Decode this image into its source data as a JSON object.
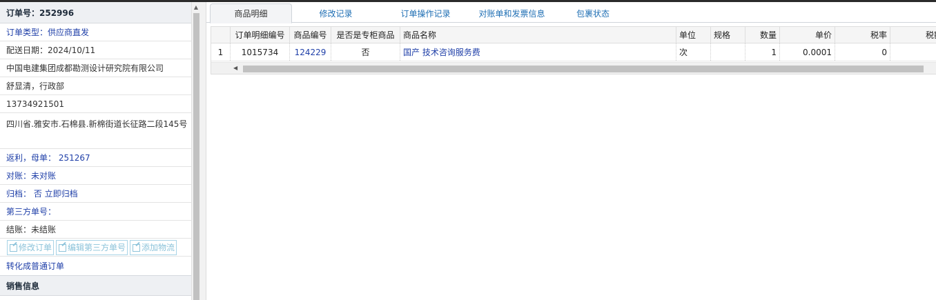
{
  "order": {
    "header": "订单号：252996",
    "rows": [
      {
        "text": "订单类型：供应商直发",
        "blue": true
      },
      {
        "text": "配送日期：2024/10/11",
        "blue": false
      },
      {
        "text": "中国电建集团成都勘测设计研究院有限公司",
        "blue": false
      },
      {
        "text": "舒显清，行政部",
        "blue": false
      },
      {
        "text": "13734921501",
        "blue": false
      },
      {
        "text": "四川省.雅安市.石棉县.新棉街道长征路二段145号",
        "blue": false,
        "tall": true
      },
      {
        "text": "返利，母单： 251267",
        "blue": true
      },
      {
        "text": "对账：未对账",
        "blue": true
      },
      {
        "text": "归档： 否 立即归档",
        "blue": true
      },
      {
        "text": "第三方单号：",
        "blue": true
      },
      {
        "text": "结账：未结账",
        "blue": false
      }
    ],
    "buttons": [
      "修改订单",
      "编辑第三方单号",
      "添加物流"
    ],
    "convert_link": "转化成普通订单",
    "section_title": "销售信息"
  },
  "tabs": [
    {
      "label": "商品明细",
      "active": true
    },
    {
      "label": "修改记录",
      "active": false
    },
    {
      "label": "订单操作记录",
      "active": false
    },
    {
      "label": "对账单和发票信息",
      "active": false
    },
    {
      "label": "包裹状态",
      "active": false
    }
  ],
  "grid": {
    "columns": [
      "",
      "订单明细编号",
      "商品编号",
      "是否是专柜商品",
      "商品名称",
      "单位",
      "规格",
      "数量",
      "单价",
      "税率",
      "税额"
    ],
    "rows": [
      [
        "1",
        "1015734",
        "124229",
        "否",
        "国产 技术咨询服务费",
        "次",
        "",
        "1",
        "0.0001",
        "0",
        ""
      ]
    ]
  },
  "colors": {
    "link": "#1f3fa8",
    "tab_link": "#1f6fb4",
    "disabled_button": "#8cc3da"
  }
}
